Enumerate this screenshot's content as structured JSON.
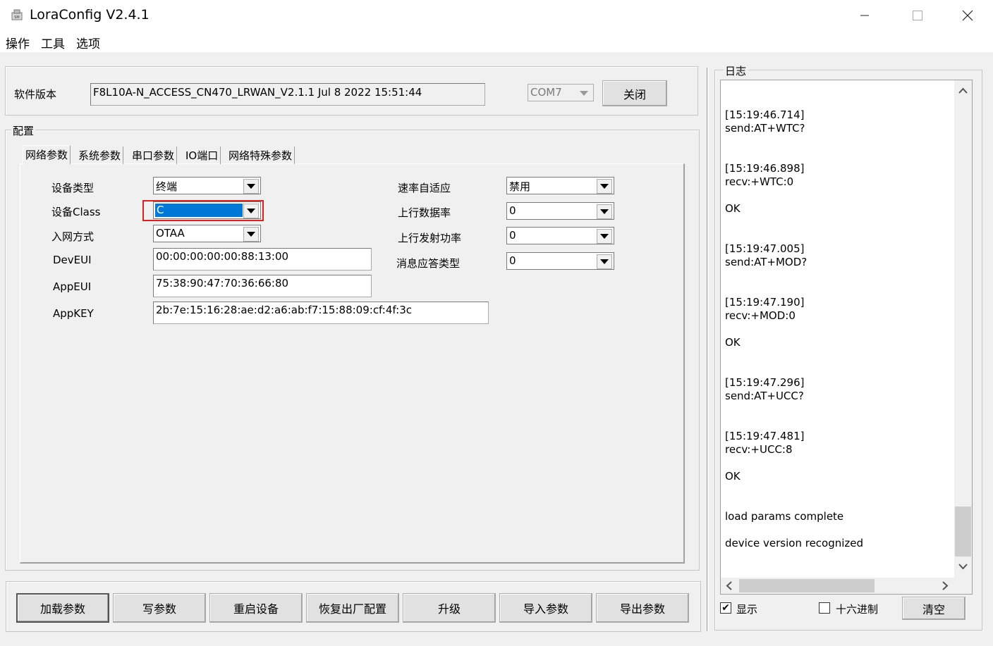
{
  "window": {
    "title": "LoraConfig V2.4.1",
    "minimize_icon": "minimize-icon",
    "maximize_icon": "maximize-icon",
    "close_icon": "close-icon"
  },
  "menu": [
    "操作",
    "工具",
    "选项"
  ],
  "version": {
    "label": "软件版本",
    "value": "F8L10A-N_ACCESS_CN470_LRWAN_V2.1.1 Jul  8 2022 15:51:44",
    "port": "COM7",
    "close_button": "关闭"
  },
  "config": {
    "title": "配置",
    "tabs": [
      "网络参数",
      "系统参数",
      "串口参数",
      "IO端口",
      "网络特殊参数"
    ],
    "left_fields": {
      "device_type": {
        "label": "设备类型",
        "value": "终端"
      },
      "device_class": {
        "label": "设备Class",
        "value": "C"
      },
      "join_mode": {
        "label": "入网方式",
        "value": "OTAA"
      },
      "deveui": {
        "label": "DevEUI",
        "value": "00:00:00:00:00:88:13:00"
      },
      "appeui": {
        "label": "AppEUI",
        "value": "75:38:90:47:70:36:66:80"
      },
      "appkey": {
        "label": "AppKEY",
        "value": "2b:7e:15:16:28:ae:d2:a6:ab:f7:15:88:09:cf:4f:3c"
      }
    },
    "right_fields": {
      "adr": {
        "label": "速率自适应",
        "value": "禁用"
      },
      "uplink_dr": {
        "label": "上行数据率",
        "value": "0"
      },
      "uplink_power": {
        "label": "上行发射功率",
        "value": "0"
      },
      "ack_type": {
        "label": "消息应答类型",
        "value": "0"
      }
    }
  },
  "buttons": [
    "加载参数",
    "写参数",
    "重启设备",
    "恢复出厂配置",
    "升级",
    "导入参数",
    "导出参数"
  ],
  "log": {
    "title": "日志",
    "lines": [
      "[15:19:46.714]",
      "send:AT+WTC?",
      "",
      "",
      "[15:19:46.898]",
      "recv:+WTC:0",
      "",
      "OK",
      "",
      "",
      "[15:19:47.005]",
      "send:AT+MOD?",
      "",
      "",
      "[15:19:47.190]",
      "recv:+MOD:0",
      "",
      "OK",
      "",
      "",
      "[15:19:47.296]",
      "send:AT+UCC?",
      "",
      "",
      "[15:19:47.481]",
      "recv:+UCC:8",
      "",
      "OK",
      "",
      "",
      "load params complete",
      "",
      "device version recognized"
    ],
    "show_label": "显示",
    "show_checked": true,
    "hex_label": "十六进制",
    "hex_checked": false,
    "clear_button": "清空"
  },
  "colors": {
    "selection": "#0078d7",
    "highlight_border": "#e02020"
  }
}
